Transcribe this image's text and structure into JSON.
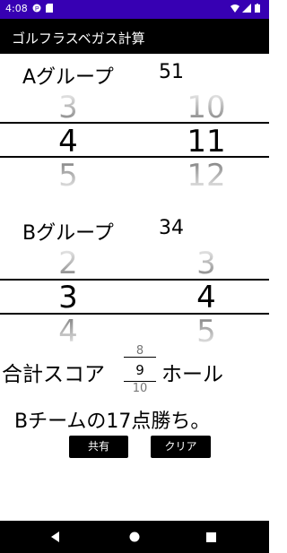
{
  "status": {
    "time": "4:08"
  },
  "app": {
    "title": "ゴルフラスベガス計算"
  },
  "groupA": {
    "label": "Aグループ",
    "score": "51",
    "picker1": {
      "prev": "3",
      "selected": "4",
      "next": "5"
    },
    "picker2": {
      "prev": "10",
      "selected": "11",
      "next": "12"
    }
  },
  "groupB": {
    "label": "Bグループ",
    "score": "34",
    "picker1": {
      "prev": "2",
      "selected": "3",
      "next": "4"
    },
    "picker2": {
      "prev": "3",
      "selected": "4",
      "next": "5"
    }
  },
  "total": {
    "prefix": "合計スコア",
    "suffix": "ホール",
    "hole_prev": "8",
    "hole_selected": "9",
    "hole_next": "10"
  },
  "result": {
    "text": "Bチームの17点勝ち。"
  },
  "buttons": {
    "share": "共有",
    "clear": "クリア"
  },
  "icons": {
    "status": [
      "p-icon",
      "sd-card-icon",
      "wifi-icon",
      "signal-icon",
      "battery-icon"
    ],
    "nav": [
      "back-icon",
      "home-icon",
      "recents-icon"
    ]
  },
  "colors": {
    "statusbar": "#3700b3",
    "appbar": "#000000",
    "button": "#000000"
  }
}
